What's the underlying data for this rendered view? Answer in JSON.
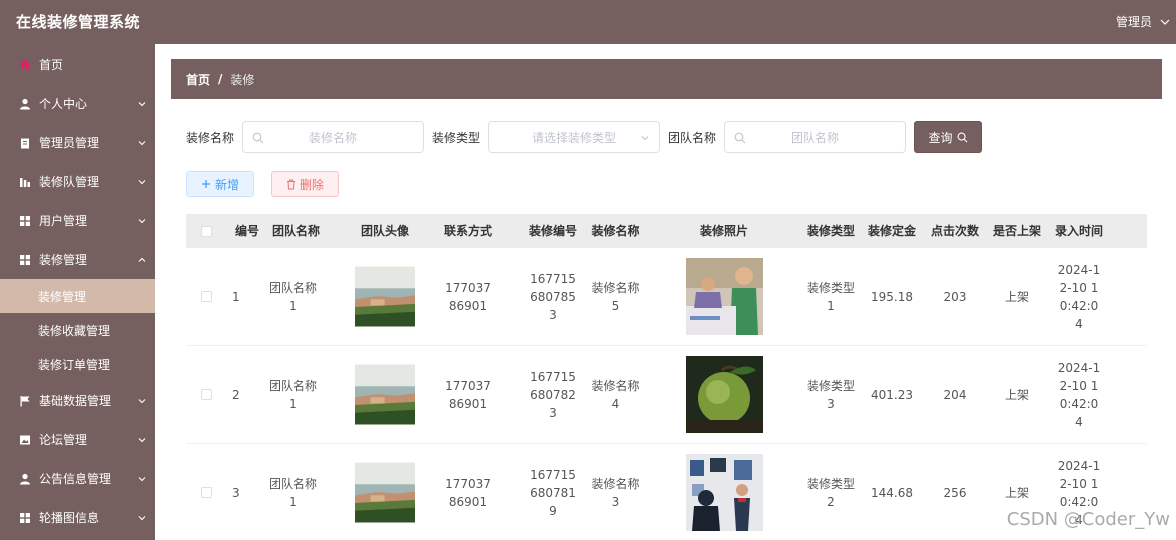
{
  "header": {
    "title": "在线装修管理系统",
    "user": "管理员"
  },
  "sidebar": {
    "items": [
      {
        "label": "首页",
        "icon": "home-icon",
        "has_children": false
      },
      {
        "label": "个人中心",
        "icon": "user-icon",
        "has_children": true
      },
      {
        "label": "管理员管理",
        "icon": "clipboard-icon",
        "has_children": true
      },
      {
        "label": "装修队管理",
        "icon": "chart-icon",
        "has_children": true
      },
      {
        "label": "用户管理",
        "icon": "grid-icon",
        "has_children": true
      },
      {
        "label": "装修管理",
        "icon": "grid-icon",
        "has_children": true
      },
      {
        "label": "基础数据管理",
        "icon": "flag-icon",
        "has_children": true
      },
      {
        "label": "论坛管理",
        "icon": "image-icon",
        "has_children": true
      },
      {
        "label": "公告信息管理",
        "icon": "user-icon",
        "has_children": true
      },
      {
        "label": "轮播图信息",
        "icon": "grid-icon",
        "has_children": true
      }
    ],
    "sub_items": [
      {
        "label": "装修管理",
        "active": true
      },
      {
        "label": "装修收藏管理",
        "active": false
      },
      {
        "label": "装修订单管理",
        "active": false
      }
    ],
    "accent_color": "#76605f",
    "active_color": "#d3b9a9"
  },
  "breadcrumb": {
    "home": "首页",
    "separator": "/",
    "current": "装修"
  },
  "filters": {
    "name_label": "装修名称",
    "name_placeholder": "装修名称",
    "type_label": "装修类型",
    "type_placeholder": "请选择装修类型",
    "team_label": "团队名称",
    "team_placeholder": "团队名称",
    "search_label": "查询"
  },
  "actions": {
    "add_label": "新增",
    "delete_label": "删除"
  },
  "table": {
    "headers": [
      "编号",
      "团队名称",
      "团队头像",
      "联系方式",
      "装修编号",
      "装修名称",
      "装修照片",
      "装修类型",
      "装修定金",
      "点击次数",
      "是否上架",
      "录入时间"
    ],
    "rows": [
      {
        "id": "1",
        "team": "团队名称1",
        "phone": "17703786901",
        "code": "1677156807853",
        "name": "装修名称5",
        "photo": "children-classroom",
        "type": "装修类型1",
        "deposit": "195.18",
        "clicks": "203",
        "listed": "上架",
        "time": "2024-12-10 10:42:04"
      },
      {
        "id": "2",
        "team": "团队名称1",
        "phone": "17703786901",
        "code": "1677156807823",
        "name": "装修名称4",
        "photo": "green-fruit",
        "type": "装修类型3",
        "deposit": "401.23",
        "clicks": "204",
        "listed": "上架",
        "time": "2024-12-10 10:42:04"
      },
      {
        "id": "3",
        "team": "团队名称1",
        "phone": "17703786901",
        "code": "1677156807819",
        "name": "装修名称3",
        "photo": "gallery-visitors",
        "type": "装修类型2",
        "deposit": "144.68",
        "clicks": "256",
        "listed": "上架",
        "time": "2024-12-10 10:42:04"
      }
    ]
  },
  "watermark": "CSDN @Coder_Yw"
}
